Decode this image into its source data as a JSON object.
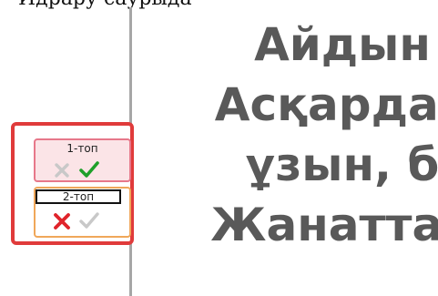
{
  "top_text": "Идрару саурыда",
  "slide": {
    "lines": [
      "Айдын",
      "Асқардан",
      "ұзын, б",
      "Жанаттан"
    ]
  },
  "groups": [
    {
      "label": "1-топ",
      "wrong_active": false,
      "right_active": true
    },
    {
      "label": "2-топ",
      "wrong_active": true,
      "right_active": false
    }
  ],
  "colors": {
    "highlight": "#e03b3b",
    "group_1_border": "#e7788a",
    "group_1_fill": "#fbe4e7",
    "group_2_border": "#f0a75a",
    "check_active": "#1fa02a",
    "cross_active": "#e0242b",
    "inactive": "#c8c8c8",
    "slide_text": "#595959"
  }
}
